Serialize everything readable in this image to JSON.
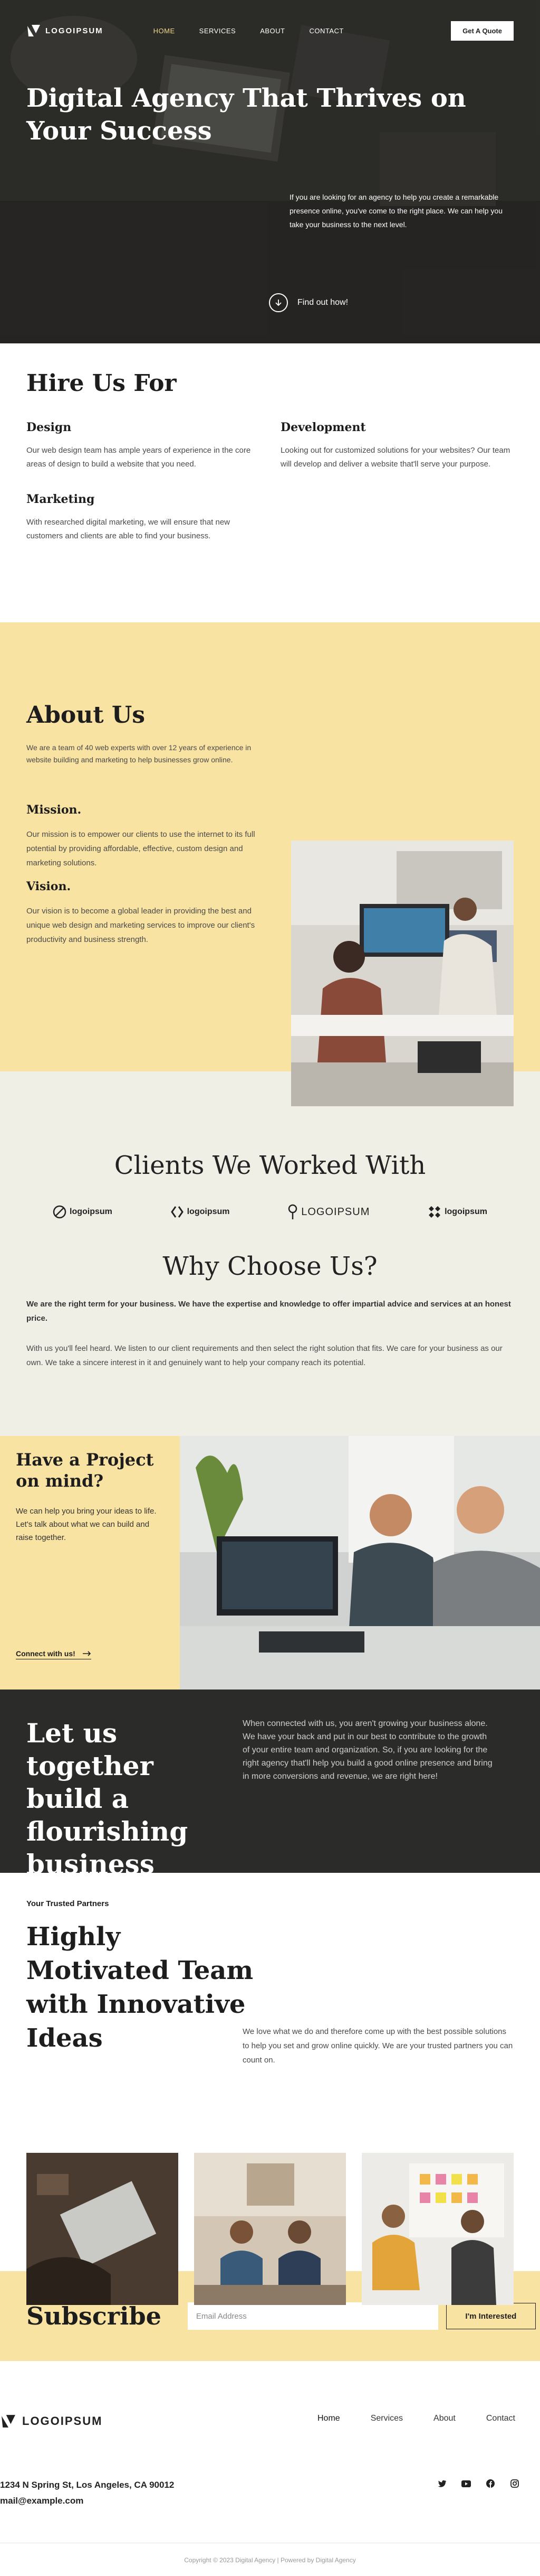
{
  "nav": {
    "logo_text": "LOGOIPSUM",
    "links": [
      "HOME",
      "SERVICES",
      "ABOUT",
      "CONTACT"
    ],
    "cta": "Get A Quote"
  },
  "hero": {
    "title": "Digital Agency That Thrives on Your Success",
    "text": "If you are looking for an agency to help you create a remarkable presence online, you've come to the right place. We can help you take your business to the next level.",
    "find_out": "Find out how!"
  },
  "hire": {
    "title": "Hire Us For",
    "items": [
      {
        "title": "Design",
        "text": "Our web design team has ample years of experience in the core areas of design to build a website that you need."
      },
      {
        "title": "Development",
        "text": "Looking out for customized solutions for your websites? Our team will develop and deliver a website that'll serve your purpose."
      },
      {
        "title": "Marketing",
        "text": "With researched digital marketing, we will ensure that new customers and clients are able to find your business."
      }
    ]
  },
  "about": {
    "title": "About Us",
    "lead": "We are a team of 40 web experts with over 12 years of experience in website building and marketing to help businesses grow online.",
    "mission_title": "Mission.",
    "mission_text": "Our mission is to empower our clients to use the internet to its full potential by providing affordable, effective, custom design and marketing solutions.",
    "vision_title": "Vision.",
    "vision_text": "Our vision is to become a global leader in providing the best and unique web design and marketing services to improve our client's productivity and business strength."
  },
  "clients": {
    "title": "Clients We Worked With",
    "logos": [
      "logoipsum",
      "logoipsum",
      "LOGOIPSUM",
      "logoipsum"
    ]
  },
  "why": {
    "title": "Why Choose Us?",
    "bold": "We are the right term for your business. We have the expertise and knowledge to offer impartial advice and services at an honest price.",
    "text": "With us you'll feel heard. We listen to our client requirements and then select the right solution that fits. We care for your business as our own. We take a sincere interest in it and genuinely want to help your company reach its potential."
  },
  "project": {
    "title": "Have a Project on mind?",
    "text": "We can help you bring your ideas to life. Let's talk about what we can build and raise together.",
    "connect": "Connect with us!"
  },
  "together": {
    "title": "Let us together build a flourishing business",
    "text": "When connected with us, you aren't growing your business alone. We have your back and put in our best to contribute to the growth of your entire team and organization. So, if you are looking for the right agency that'll help you build a good online presence and bring in more conversions and revenue, we are right here!"
  },
  "partners": {
    "eyebrow": "Your Trusted Partners",
    "title": "Highly Motivated Team with Innovative Ideas",
    "text": "We love what we do and therefore come up with the best possible solutions to help you set and grow online quickly. We are your trusted partners you can count on."
  },
  "subscribe": {
    "title": "Subscribe",
    "placeholder": "Email Address",
    "button": "I'm Interested"
  },
  "footer": {
    "logo_text": "LOGOIPSUM",
    "links": [
      "Home",
      "Services",
      "About",
      "Contact"
    ],
    "address": "1234 N Spring St, Los Angeles, CA 90012",
    "email": "mail@example.com",
    "copyright": "Copyright © 2023 Digital Agency | Powered by Digital Agency"
  },
  "colors": {
    "accent_yellow": "#f9e3a2",
    "dark": "#2b2b2a",
    "cream": "#f0efe6"
  }
}
